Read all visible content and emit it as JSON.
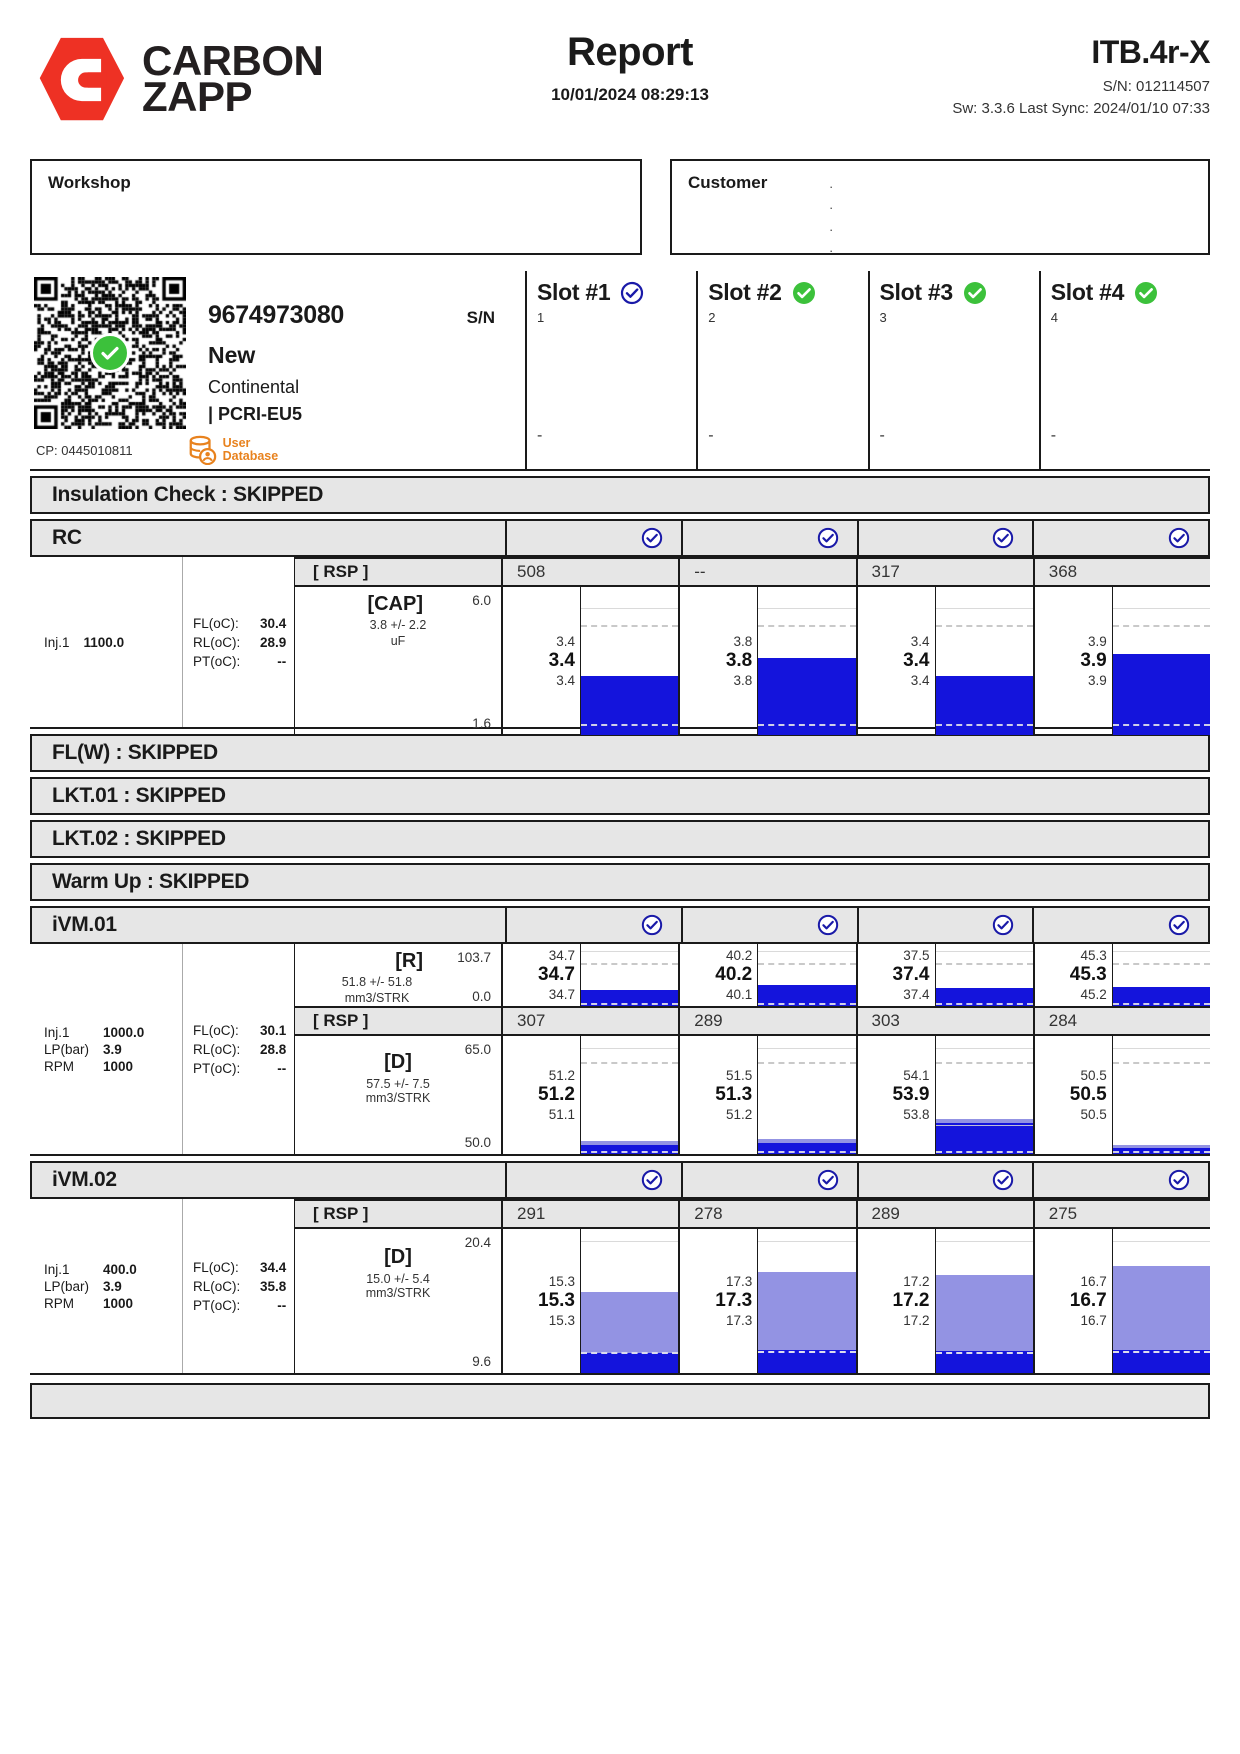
{
  "header": {
    "logo_line1": "CARBON",
    "logo_line2": "ZAPP",
    "logo_icon": "carbon-zapp-hexagon-c-logo",
    "title": "Report",
    "datetime": "10/01/2024 08:29:13",
    "model": "ITB.4r-X",
    "serial": "S/N: 012114507",
    "software": "Sw: 3.3.6 Last Sync: 2024/01/10 07:33"
  },
  "info": {
    "workshop_label": "Workshop",
    "workshop_value": "",
    "customer_label": "Customer",
    "customer_lines": [
      ".",
      ".",
      ".",
      "."
    ]
  },
  "identity": {
    "part_number": "9674973080",
    "sn_label": "S/N",
    "sn_value": "",
    "condition": "New",
    "brand": "Continental",
    "code": "| PCRI-EU5",
    "cp": "CP: 0445010811",
    "database_line1": "User",
    "database_line2": "Database",
    "qr_status": "ok"
  },
  "slots": [
    {
      "title": "Slot #1",
      "number": "1",
      "value": "-",
      "status": "outline"
    },
    {
      "title": "Slot #2",
      "number": "2",
      "value": "-",
      "status": "filled"
    },
    {
      "title": "Slot #3",
      "number": "3",
      "value": "-",
      "status": "filled"
    },
    {
      "title": "Slot #4",
      "number": "4",
      "value": "-",
      "status": "filled"
    }
  ],
  "sections": {
    "insulation": "Insulation Check : SKIPPED",
    "rc": "RC",
    "flw": "FL(W) : SKIPPED",
    "lkt01": "LKT.01 : SKIPPED",
    "lkt02": "LKT.02 : SKIPPED",
    "warmup": "Warm Up : SKIPPED",
    "ivm01": "iVM.01",
    "ivm02": "iVM.02"
  },
  "rc": {
    "params": [
      {
        "k": "Inj.1",
        "v": "1100.0"
      }
    ],
    "temps": [
      {
        "k": "FL(oC):",
        "v": "30.4"
      },
      {
        "k": "RL(oC):",
        "v": "28.9"
      },
      {
        "k": "PT(oC):",
        "v": "--"
      }
    ],
    "rsp_label": "[ RSP ]",
    "rsp_values": [
      "508",
      "--",
      "317",
      "368"
    ],
    "metric": {
      "code": "[CAP]",
      "spec": "3.8 +/- 2.2",
      "unit": "uF",
      "max": "6.0",
      "min": "1.6"
    },
    "cells": [
      {
        "high": "3.4",
        "main": "3.4",
        "low": "3.4"
      },
      {
        "high": "3.8",
        "main": "3.8",
        "low": "3.8"
      },
      {
        "high": "3.4",
        "main": "3.4",
        "low": "3.4"
      },
      {
        "high": "3.9",
        "main": "3.9",
        "low": "3.9"
      }
    ]
  },
  "ivm01": {
    "params": [
      {
        "k": "Inj.1",
        "v": "1000.0"
      },
      {
        "k": "LP(bar)",
        "v": "3.9"
      },
      {
        "k": "RPM",
        "v": "1000"
      }
    ],
    "temps": [
      {
        "k": "FL(oC):",
        "v": "30.1"
      },
      {
        "k": "RL(oC):",
        "v": "28.8"
      },
      {
        "k": "PT(oC):",
        "v": "--"
      }
    ],
    "r_metric": {
      "code": "[R]",
      "spec": "51.8 +/- 51.8",
      "unit": "mm3/STRK",
      "max": "103.7",
      "min": "0.0"
    },
    "r_cells": [
      {
        "high": "34.7",
        "main": "34.7",
        "low": "34.7"
      },
      {
        "high": "40.2",
        "main": "40.2",
        "low": "40.1"
      },
      {
        "high": "37.5",
        "main": "37.4",
        "low": "37.4"
      },
      {
        "high": "45.3",
        "main": "45.3",
        "low": "45.2"
      }
    ],
    "rsp_label": "[ RSP ]",
    "rsp_values": [
      "307",
      "289",
      "303",
      "284"
    ],
    "d_metric": {
      "code": "[D]",
      "spec": "57.5 +/- 7.5",
      "unit": "mm3/STRK",
      "max": "65.0",
      "min": "50.0"
    },
    "d_cells": [
      {
        "high": "51.2",
        "main": "51.2",
        "low": "51.1"
      },
      {
        "high": "51.5",
        "main": "51.3",
        "low": "51.2"
      },
      {
        "high": "54.1",
        "main": "53.9",
        "low": "53.8"
      },
      {
        "high": "50.5",
        "main": "50.5",
        "low": "50.5"
      }
    ]
  },
  "ivm02": {
    "params": [
      {
        "k": "Inj.1",
        "v": "400.0"
      },
      {
        "k": "LP(bar)",
        "v": "3.9"
      },
      {
        "k": "RPM",
        "v": "1000"
      }
    ],
    "temps": [
      {
        "k": "FL(oC):",
        "v": "34.4"
      },
      {
        "k": "RL(oC):",
        "v": "35.8"
      },
      {
        "k": "PT(oC):",
        "v": "--"
      }
    ],
    "rsp_label": "[ RSP ]",
    "rsp_values": [
      "291",
      "278",
      "289",
      "275"
    ],
    "d_metric": {
      "code": "[D]",
      "spec": "15.0 +/- 5.4",
      "unit": "mm3/STRK",
      "max": "20.4",
      "min": "9.6"
    },
    "d_cells": [
      {
        "high": "15.3",
        "main": "15.3",
        "low": "15.3"
      },
      {
        "high": "17.3",
        "main": "17.3",
        "low": "17.3"
      },
      {
        "high": "17.2",
        "main": "17.2",
        "low": "17.2"
      },
      {
        "high": "16.7",
        "main": "16.7",
        "low": "16.7"
      }
    ]
  },
  "colors": {
    "brand_red": "#ee3124",
    "bar_blue": "#1414dc",
    "check_green": "#3cc13b",
    "check_blue": "#1a1aa8",
    "band_grey": "#e6e6e6",
    "orange": "#e8821e"
  },
  "chart_data": {
    "type": "bar",
    "title": "Injector test results per slot",
    "charts": [
      {
        "section": "RC",
        "metric": "[CAP]",
        "unit": "uF",
        "ylim": [
          1.6,
          6.0
        ],
        "nominal": 3.8,
        "tolerance": 2.2,
        "categories": [
          "Slot #1",
          "Slot #2",
          "Slot #3",
          "Slot #4"
        ],
        "values": [
          3.4,
          3.8,
          3.4,
          3.9
        ]
      },
      {
        "section": "iVM.01",
        "metric": "[R]",
        "unit": "mm3/STRK",
        "ylim": [
          0.0,
          103.7
        ],
        "nominal": 51.8,
        "tolerance": 51.8,
        "categories": [
          "Slot #1",
          "Slot #2",
          "Slot #3",
          "Slot #4"
        ],
        "values": [
          34.7,
          40.2,
          37.4,
          45.3
        ]
      },
      {
        "section": "iVM.01",
        "metric": "[D]",
        "unit": "mm3/STRK",
        "ylim": [
          50.0,
          65.0
        ],
        "nominal": 57.5,
        "tolerance": 7.5,
        "categories": [
          "Slot #1",
          "Slot #2",
          "Slot #3",
          "Slot #4"
        ],
        "values": [
          51.2,
          51.3,
          53.9,
          50.5
        ]
      },
      {
        "section": "iVM.02",
        "metric": "[D]",
        "unit": "mm3/STRK",
        "ylim": [
          9.6,
          20.4
        ],
        "nominal": 15.0,
        "tolerance": 5.4,
        "categories": [
          "Slot #1",
          "Slot #2",
          "Slot #3",
          "Slot #4"
        ],
        "values": [
          15.3,
          17.3,
          17.2,
          16.7
        ]
      }
    ]
  }
}
